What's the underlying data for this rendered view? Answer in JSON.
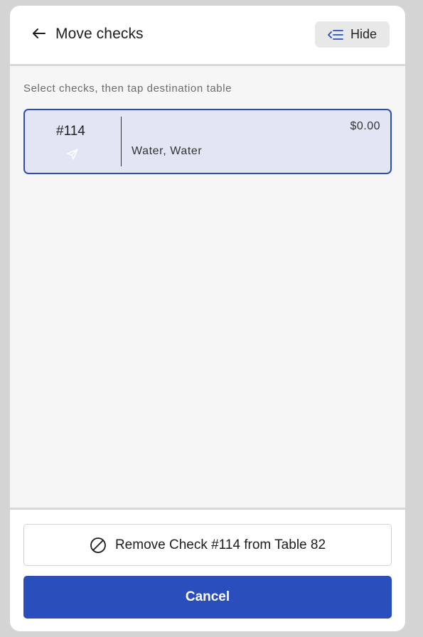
{
  "header": {
    "title": "Move checks",
    "back_icon": "arrow-left-icon",
    "hide_button": {
      "label": "Hide",
      "icon": "collapse-list-icon"
    }
  },
  "instruction": "Select checks, then tap destination table",
  "checks": [
    {
      "number": "#114",
      "status_icon": "send-icon",
      "items": "Water, Water",
      "amount": "$0.00",
      "selected": true
    }
  ],
  "footer": {
    "remove_button": {
      "label": "Remove Check #114 from Table 82",
      "icon": "prohibited-icon"
    },
    "cancel_button": {
      "label": "Cancel"
    }
  },
  "colors": {
    "accent": "#2a4fbd",
    "selected_card_bg": "#e2e5f4",
    "panel_bg": "#f6f6f6"
  }
}
